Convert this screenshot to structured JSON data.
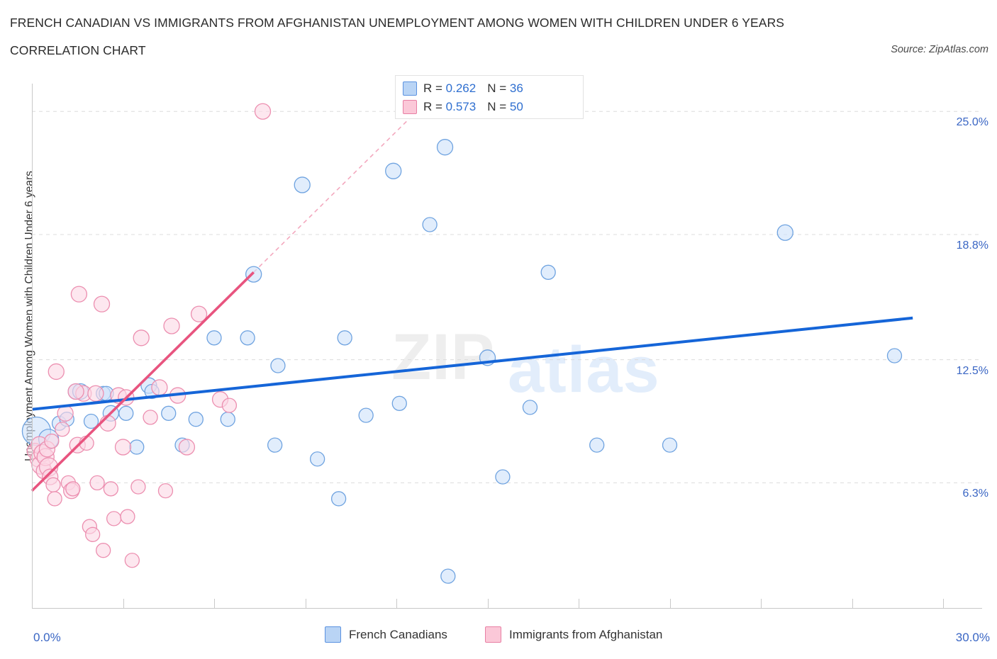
{
  "header": {
    "title": "FRENCH CANADIAN VS IMMIGRANTS FROM AFGHANISTAN UNEMPLOYMENT AMONG WOMEN WITH CHILDREN UNDER 6 YEARS",
    "subtitle": "CORRELATION CHART",
    "source": "Source: ZipAtlas.com"
  },
  "watermark": {
    "part1": "ZIP",
    "part2": "atlas"
  },
  "stats": {
    "blue": {
      "r_label": "R = ",
      "r_value": "0.262",
      "n_label": "N = ",
      "n_value": "36"
    },
    "pink": {
      "r_label": "R = ",
      "r_value": "0.573",
      "n_label": "N = ",
      "n_value": "50"
    }
  },
  "legend": {
    "blue_label": "French Canadians",
    "pink_label": "Immigrants from Afghanistan"
  },
  "colors": {
    "blue_fill": "#cfe2fa",
    "blue_stroke": "#6fa3e0",
    "pink_fill": "#fcd9e5",
    "pink_stroke": "#ec8fb0",
    "blue_line": "#1565d8",
    "pink_line": "#e8547f",
    "axis": "#c8c8c8",
    "grid": "#dcdcdc",
    "tick_text": "#3a66c4"
  },
  "chart_data": {
    "type": "scatter",
    "title": "FRENCH CANADIAN VS IMMIGRANTS FROM AFGHANISTAN UNEMPLOYMENT AMONG WOMEN WITH CHILDREN UNDER 6 YEARS",
    "subtitle": "CORRELATION CHART",
    "xlabel": "",
    "ylabel": "Unemployment Among Women with Children Under 6 years",
    "xlim": [
      0.0,
      30.0
    ],
    "ylim": [
      0.0,
      26.4
    ],
    "x_tick_labels": [
      "0.0%",
      "30.0%"
    ],
    "y_tick_labels": [
      "25.0%",
      "18.8%",
      "12.5%",
      "6.3%"
    ],
    "y_gridlines": [
      25.0,
      18.8,
      12.5,
      6.3
    ],
    "grid": true,
    "legend_position": "bottom",
    "series": [
      {
        "name": "French Canadians",
        "color": "#cfe2fa",
        "r": 0.262,
        "n": 36,
        "trend": {
          "x0": 0.0,
          "y0": 10.0,
          "x1": 29.0,
          "y1": 14.6,
          "style": "solid"
        },
        "points": [
          {
            "x": 0.15,
            "y": 8.9,
            "r": 20
          },
          {
            "x": 0.55,
            "y": 8.5,
            "r": 14
          },
          {
            "x": 0.9,
            "y": 9.3,
            "r": 10
          },
          {
            "x": 1.15,
            "y": 9.5,
            "r": 10
          },
          {
            "x": 1.45,
            "y": 10.9,
            "r": 11
          },
          {
            "x": 1.6,
            "y": 10.9,
            "r": 11
          },
          {
            "x": 1.95,
            "y": 9.4,
            "r": 10
          },
          {
            "x": 2.35,
            "y": 10.8,
            "r": 10
          },
          {
            "x": 2.45,
            "y": 10.8,
            "r": 10
          },
          {
            "x": 2.6,
            "y": 9.8,
            "r": 11
          },
          {
            "x": 3.1,
            "y": 9.8,
            "r": 10
          },
          {
            "x": 3.45,
            "y": 8.1,
            "r": 10
          },
          {
            "x": 3.85,
            "y": 11.2,
            "r": 11
          },
          {
            "x": 3.95,
            "y": 10.9,
            "r": 10
          },
          {
            "x": 4.5,
            "y": 9.8,
            "r": 10
          },
          {
            "x": 4.95,
            "y": 8.2,
            "r": 10
          },
          {
            "x": 5.4,
            "y": 9.5,
            "r": 10
          },
          {
            "x": 6.0,
            "y": 13.6,
            "r": 10
          },
          {
            "x": 6.45,
            "y": 9.5,
            "r": 10
          },
          {
            "x": 7.1,
            "y": 13.6,
            "r": 10
          },
          {
            "x": 7.3,
            "y": 16.8,
            "r": 11
          },
          {
            "x": 8.1,
            "y": 12.2,
            "r": 10
          },
          {
            "x": 8.0,
            "y": 8.2,
            "r": 10
          },
          {
            "x": 9.4,
            "y": 7.5,
            "r": 10
          },
          {
            "x": 8.9,
            "y": 21.3,
            "r": 11
          },
          {
            "x": 10.1,
            "y": 5.5,
            "r": 10
          },
          {
            "x": 10.3,
            "y": 13.6,
            "r": 10
          },
          {
            "x": 11.0,
            "y": 9.7,
            "r": 10
          },
          {
            "x": 11.9,
            "y": 22.0,
            "r": 11
          },
          {
            "x": 12.1,
            "y": 10.3,
            "r": 10
          },
          {
            "x": 13.1,
            "y": 19.3,
            "r": 10
          },
          {
            "x": 13.6,
            "y": 23.2,
            "r": 11
          },
          {
            "x": 13.7,
            "y": 1.6,
            "r": 10
          },
          {
            "x": 15.0,
            "y": 12.6,
            "r": 11
          },
          {
            "x": 15.5,
            "y": 6.6,
            "r": 10
          },
          {
            "x": 16.4,
            "y": 10.1,
            "r": 10
          },
          {
            "x": 17.0,
            "y": 16.9,
            "r": 10
          },
          {
            "x": 18.6,
            "y": 8.2,
            "r": 10
          },
          {
            "x": 21.0,
            "y": 8.2,
            "r": 10
          },
          {
            "x": 24.8,
            "y": 18.9,
            "r": 11
          },
          {
            "x": 28.4,
            "y": 12.7,
            "r": 10
          }
        ]
      },
      {
        "name": "Immigrants from Afghanistan",
        "color": "#fcd9e5",
        "r": 0.573,
        "n": 50,
        "trend": {
          "x0": 0.0,
          "y0": 5.9,
          "x1": 7.3,
          "y1": 16.9,
          "style": "solid"
        },
        "trend_dashed": {
          "x0": 7.3,
          "y0": 16.9,
          "x1": 12.8,
          "y1": 25.2,
          "style": "dashed"
        },
        "points": [
          {
            "x": 0.1,
            "y": 7.9,
            "r": 11
          },
          {
            "x": 0.2,
            "y": 7.5,
            "r": 11
          },
          {
            "x": 0.25,
            "y": 8.2,
            "r": 12
          },
          {
            "x": 0.3,
            "y": 7.2,
            "r": 13
          },
          {
            "x": 0.35,
            "y": 7.8,
            "r": 12
          },
          {
            "x": 0.4,
            "y": 6.9,
            "r": 11
          },
          {
            "x": 0.45,
            "y": 7.6,
            "r": 12
          },
          {
            "x": 0.5,
            "y": 8.0,
            "r": 11
          },
          {
            "x": 0.55,
            "y": 7.1,
            "r": 13
          },
          {
            "x": 0.6,
            "y": 6.6,
            "r": 11
          },
          {
            "x": 0.65,
            "y": 8.4,
            "r": 10
          },
          {
            "x": 0.7,
            "y": 6.2,
            "r": 10
          },
          {
            "x": 0.75,
            "y": 5.5,
            "r": 10
          },
          {
            "x": 0.8,
            "y": 11.9,
            "r": 11
          },
          {
            "x": 1.0,
            "y": 9.0,
            "r": 10
          },
          {
            "x": 1.1,
            "y": 9.8,
            "r": 11
          },
          {
            "x": 1.2,
            "y": 6.3,
            "r": 10
          },
          {
            "x": 1.3,
            "y": 5.9,
            "r": 11
          },
          {
            "x": 1.35,
            "y": 6.0,
            "r": 10
          },
          {
            "x": 1.5,
            "y": 8.2,
            "r": 11
          },
          {
            "x": 1.55,
            "y": 15.8,
            "r": 11
          },
          {
            "x": 1.7,
            "y": 10.8,
            "r": 11
          },
          {
            "x": 1.8,
            "y": 8.3,
            "r": 10
          },
          {
            "x": 1.9,
            "y": 4.1,
            "r": 10
          },
          {
            "x": 2.0,
            "y": 3.7,
            "r": 10
          },
          {
            "x": 2.1,
            "y": 10.8,
            "r": 11
          },
          {
            "x": 2.15,
            "y": 6.3,
            "r": 10
          },
          {
            "x": 2.3,
            "y": 15.3,
            "r": 11
          },
          {
            "x": 2.35,
            "y": 2.9,
            "r": 10
          },
          {
            "x": 2.5,
            "y": 9.3,
            "r": 11
          },
          {
            "x": 2.6,
            "y": 6.0,
            "r": 10
          },
          {
            "x": 2.7,
            "y": 4.5,
            "r": 10
          },
          {
            "x": 2.85,
            "y": 10.7,
            "r": 11
          },
          {
            "x": 3.0,
            "y": 8.1,
            "r": 11
          },
          {
            "x": 3.1,
            "y": 10.6,
            "r": 11
          },
          {
            "x": 3.15,
            "y": 4.6,
            "r": 10
          },
          {
            "x": 3.3,
            "y": 2.4,
            "r": 10
          },
          {
            "x": 3.5,
            "y": 6.1,
            "r": 10
          },
          {
            "x": 3.6,
            "y": 13.6,
            "r": 11
          },
          {
            "x": 3.9,
            "y": 9.6,
            "r": 10
          },
          {
            "x": 4.2,
            "y": 11.1,
            "r": 11
          },
          {
            "x": 4.4,
            "y": 5.9,
            "r": 10
          },
          {
            "x": 4.6,
            "y": 14.2,
            "r": 11
          },
          {
            "x": 4.8,
            "y": 10.7,
            "r": 11
          },
          {
            "x": 5.1,
            "y": 8.1,
            "r": 11
          },
          {
            "x": 5.5,
            "y": 14.8,
            "r": 11
          },
          {
            "x": 6.2,
            "y": 10.5,
            "r": 11
          },
          {
            "x": 6.5,
            "y": 10.2,
            "r": 10
          },
          {
            "x": 7.6,
            "y": 25.0,
            "r": 11
          },
          {
            "x": 1.45,
            "y": 10.9,
            "r": 11
          }
        ]
      }
    ]
  }
}
